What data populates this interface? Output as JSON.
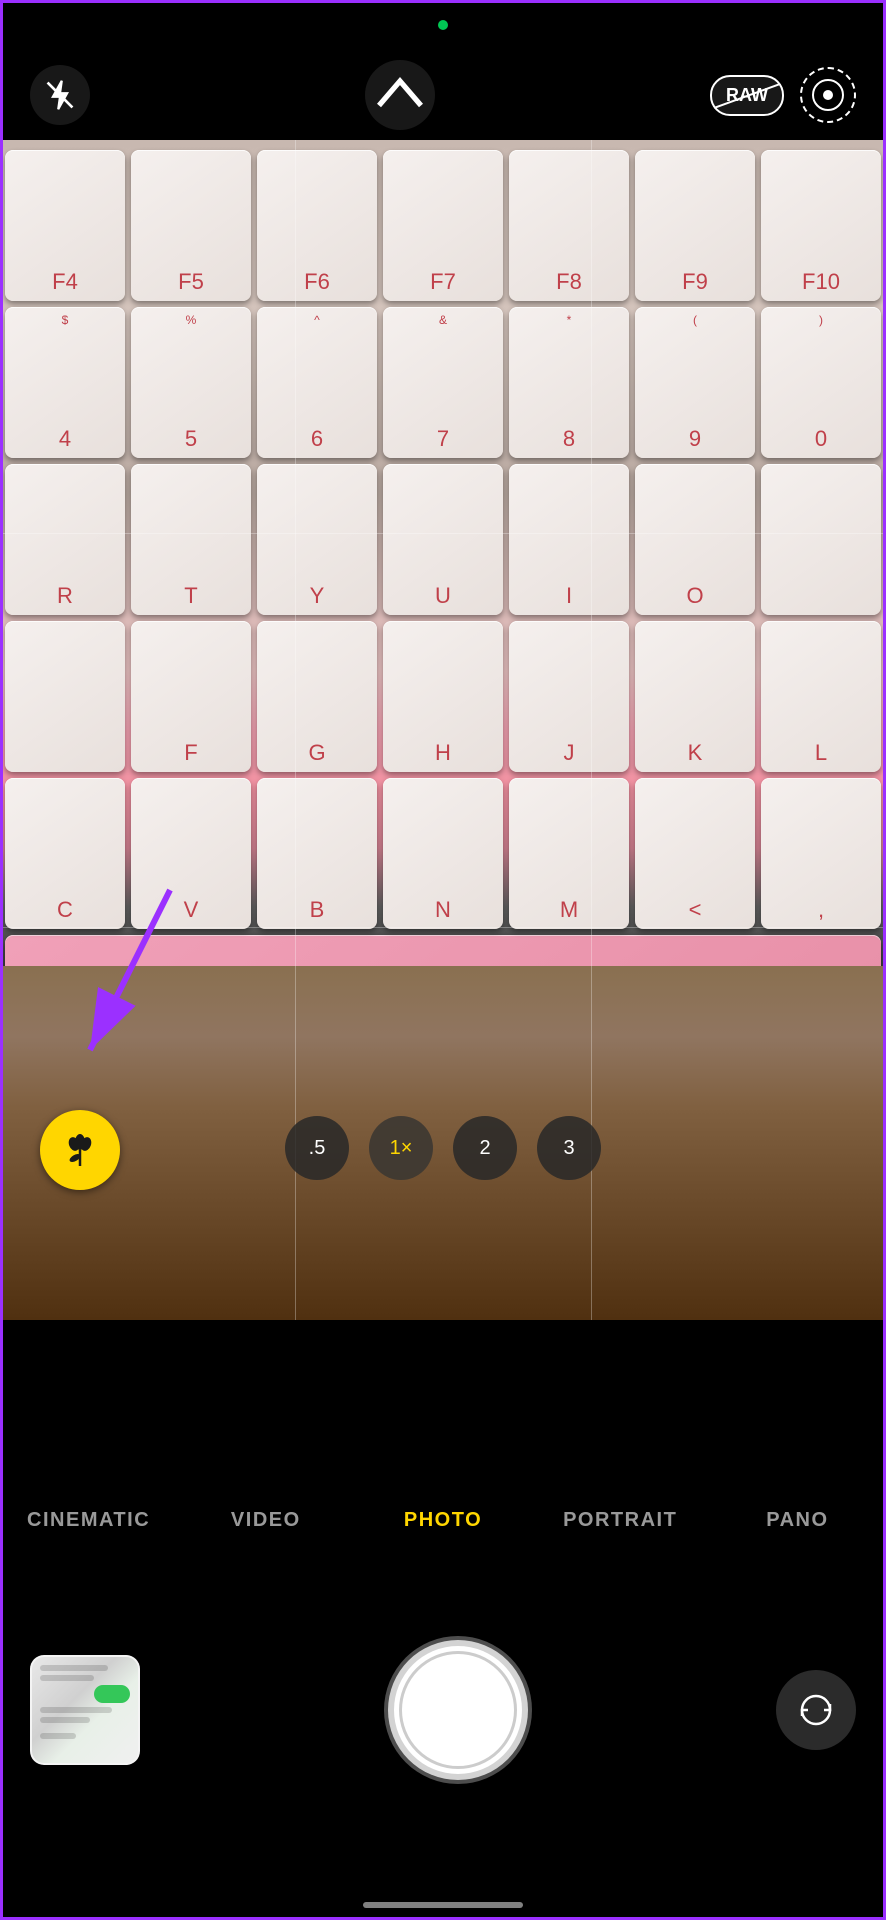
{
  "statusBar": {
    "cameraIndicatorColor": "#00c853"
  },
  "topControls": {
    "flashLabel": "flash-off",
    "collapseLabel": "^",
    "rawLabel": "RAW",
    "liveLabel": "live"
  },
  "viewfinder": {
    "gridLines": true
  },
  "zoomControls": {
    "options": [
      {
        "value": ".5",
        "active": false
      },
      {
        "value": "1×",
        "active": true
      },
      {
        "value": "2",
        "active": false
      },
      {
        "value": "3",
        "active": false
      }
    ]
  },
  "modeBar": {
    "modes": [
      {
        "label": "CINEMATIC",
        "active": false
      },
      {
        "label": "VIDEO",
        "active": false
      },
      {
        "label": "PHOTO",
        "active": true
      },
      {
        "label": "PORTRAIT",
        "active": false
      },
      {
        "label": "PANO",
        "active": false
      }
    ]
  },
  "bottomControls": {
    "shutterLabel": "shutter",
    "flipLabel": "flip-camera"
  },
  "homeIndicator": {}
}
